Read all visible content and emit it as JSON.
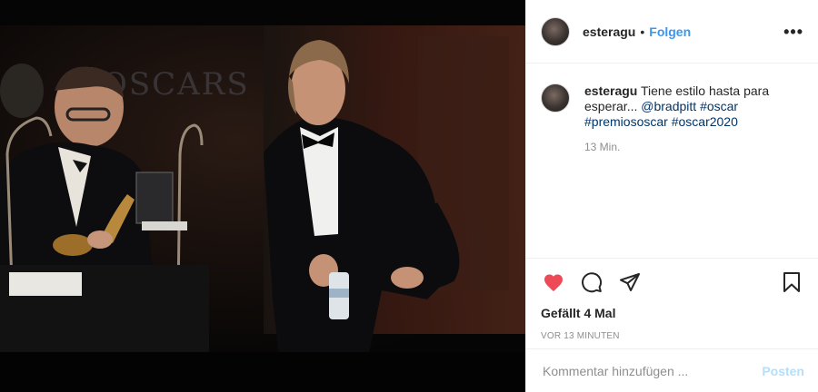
{
  "post": {
    "image_alt": "Foto"
  },
  "header": {
    "username": "esteragu",
    "separator": "•",
    "follow_label": "Folgen",
    "more_label": "•••"
  },
  "caption": {
    "username": "esteragu",
    "text": " Tiene estilo hasta para esperar... ",
    "mention": "@bradpitt",
    "hashtags": [
      "#oscar",
      "#premiososcar",
      "#oscar2020"
    ],
    "time": "13 Min."
  },
  "actions": {
    "like_icon": "heart-icon",
    "comment_icon": "comment-icon",
    "share_icon": "share-icon",
    "save_icon": "bookmark-icon",
    "like_color": "#ed4956",
    "likes_text": "Gefällt 4 Mal",
    "ago_text": "VOR 13 MINUTEN"
  },
  "comment": {
    "placeholder": "Kommentar hinzufügen ...",
    "post_label": "Posten"
  },
  "colors": {
    "link": "#003569",
    "accent": "#3897f0",
    "post_disabled": "#b2dffc",
    "muted": "#8e8e8e"
  }
}
